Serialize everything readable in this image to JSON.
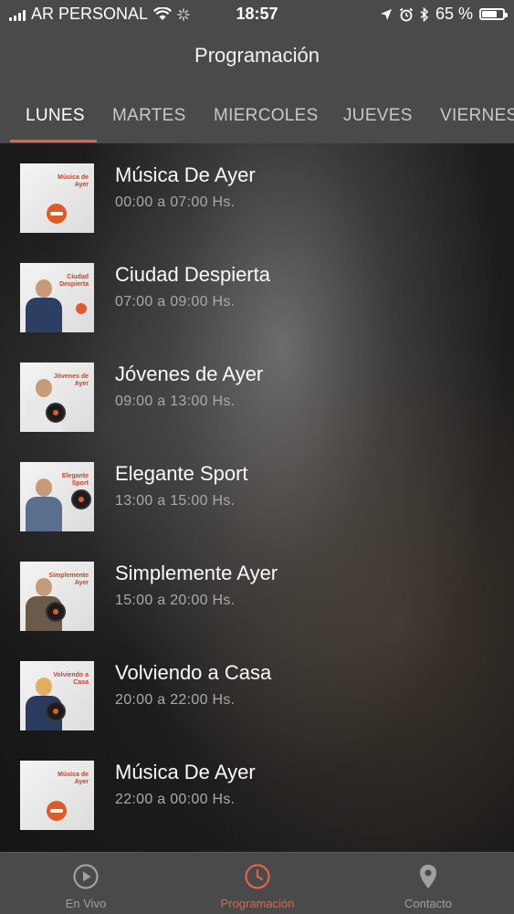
{
  "status_bar": {
    "carrier": "AR PERSONAL",
    "time": "18:57",
    "battery": "65 %",
    "battery_level": 0.65
  },
  "header": {
    "title": "Programación"
  },
  "day_tabs": [
    {
      "label": "LUNES",
      "active": true
    },
    {
      "label": "MARTES",
      "active": false
    },
    {
      "label": "MIERCOLES",
      "active": false
    },
    {
      "label": "JUEVES",
      "active": false
    },
    {
      "label": "VIERNES",
      "active": false
    }
  ],
  "programs": [
    {
      "name": "Música De Ayer",
      "time": "00:00 a 07:00 Hs.",
      "thumb_text": "Música de Ayer"
    },
    {
      "name": "Ciudad Despierta",
      "time": "07:00 a 09:00 Hs.",
      "thumb_text": "Ciudad Despierta"
    },
    {
      "name": "Jóvenes de Ayer",
      "time": "09:00 a 13:00 Hs.",
      "thumb_text": "Jóvenes de Ayer"
    },
    {
      "name": "Elegante Sport",
      "time": "13:00 a 15:00 Hs.",
      "thumb_text": "Elegante Sport"
    },
    {
      "name": "Simplemente Ayer",
      "time": "15:00 a 20:00 Hs.",
      "thumb_text": "Simplemente Ayer"
    },
    {
      "name": "Volviendo a Casa",
      "time": "20:00 a 22:00 Hs.",
      "thumb_text": "Volviendo a Casa"
    },
    {
      "name": "Música De Ayer",
      "time": "22:00 a 00:00 Hs.",
      "thumb_text": "Música de Ayer"
    }
  ],
  "tab_bar": {
    "items": [
      {
        "label": "En Vivo",
        "icon": "play-circle-icon",
        "active": false
      },
      {
        "label": "Programación",
        "icon": "clock-icon",
        "active": true
      },
      {
        "label": "Contacto",
        "icon": "location-pin-icon",
        "active": false
      }
    ]
  },
  "colors": {
    "accent": "#e2624b",
    "header_bg": "#4a4a4a",
    "subtitle": "#a9a9a9"
  }
}
